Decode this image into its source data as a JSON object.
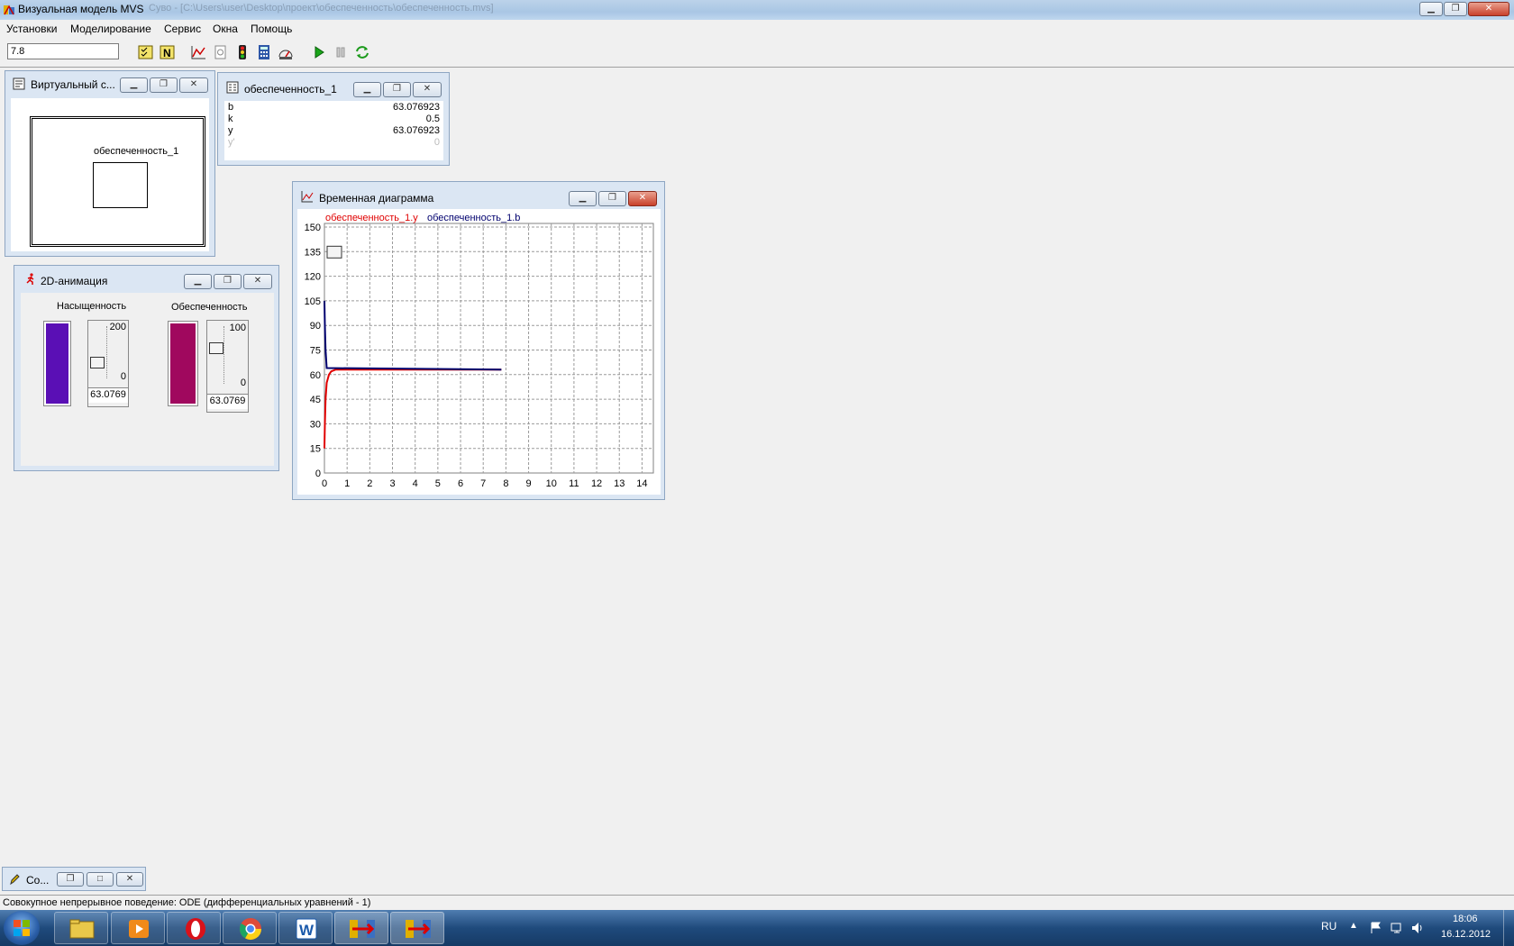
{
  "app": {
    "title": "Визуальная модель MVS",
    "path": "Суво - [C:\\Users\\user\\Desktop\\проект\\обеспеченность\\обеспеченность.mvs]"
  },
  "menu": [
    "Установки",
    "Моделирование",
    "Сервис",
    "Окна",
    "Помощь"
  ],
  "toolbar": {
    "time_value": "7.8",
    "icons": [
      "check-list-icon",
      "n-icon",
      "chart-icon",
      "copy-icon",
      "traffic-light-icon",
      "calculator-icon",
      "gauge-icon",
      "play-icon",
      "pause-icon",
      "refresh-icon"
    ]
  },
  "virtual_window": {
    "title": "Виртуальный с...",
    "block_label": "обеспеченность_1"
  },
  "vars_window": {
    "title": "обеспеченность_1",
    "rows": [
      {
        "name": "b",
        "value": "63.076923"
      },
      {
        "name": "k",
        "value": "0.5"
      },
      {
        "name": "y",
        "value": "63.076923"
      },
      {
        "name": "y'",
        "value": "0"
      }
    ]
  },
  "anim_window": {
    "title": "2D-анимация",
    "bar1": {
      "label": "Насыщенность",
      "max": "200",
      "min": "0",
      "value": "63.0769",
      "color": "#5a0fb5",
      "level_fraction": 0.315
    },
    "bar2": {
      "label": "Обеспеченность",
      "max": "100",
      "min": "0",
      "value": "63.0769",
      "color": "#a0085e",
      "level_fraction": 0.63
    }
  },
  "chart_window": {
    "title": "Временная диаграмма"
  },
  "chart_data": {
    "type": "line",
    "series": [
      {
        "name": "обеспеченность_1.y",
        "color": "#e00000",
        "x": [
          0,
          0.02,
          0.05,
          0.1,
          0.2,
          0.3,
          0.5,
          7.8
        ],
        "y": [
          15,
          30,
          45,
          55,
          60,
          62,
          63.08,
          63.08
        ]
      },
      {
        "name": "обеспеченность_1.b",
        "color": "#00006e",
        "x": [
          0,
          0.02,
          0.05,
          0.1,
          7.8
        ],
        "y": [
          105,
          90,
          75,
          64,
          63.08
        ]
      }
    ],
    "xticks": [
      "0",
      "1",
      "2",
      "3",
      "4",
      "5",
      "6",
      "7",
      "8",
      "9",
      "10",
      "11",
      "12",
      "13",
      "14"
    ],
    "yticks": [
      "0",
      "15",
      "30",
      "45",
      "60",
      "75",
      "90",
      "105",
      "120",
      "135",
      "150"
    ],
    "xlim": [
      0,
      14.5
    ],
    "ylim": [
      0,
      150
    ],
    "grid": true,
    "legend": "top-left"
  },
  "minimized_window": {
    "title": "Со..."
  },
  "status": "Совокупное непрерывное поведение: ODE (дифференциальных уравнений - 1)",
  "taskbar": {
    "lang": "RU",
    "time": "18:06",
    "date": "16.12.2012"
  }
}
